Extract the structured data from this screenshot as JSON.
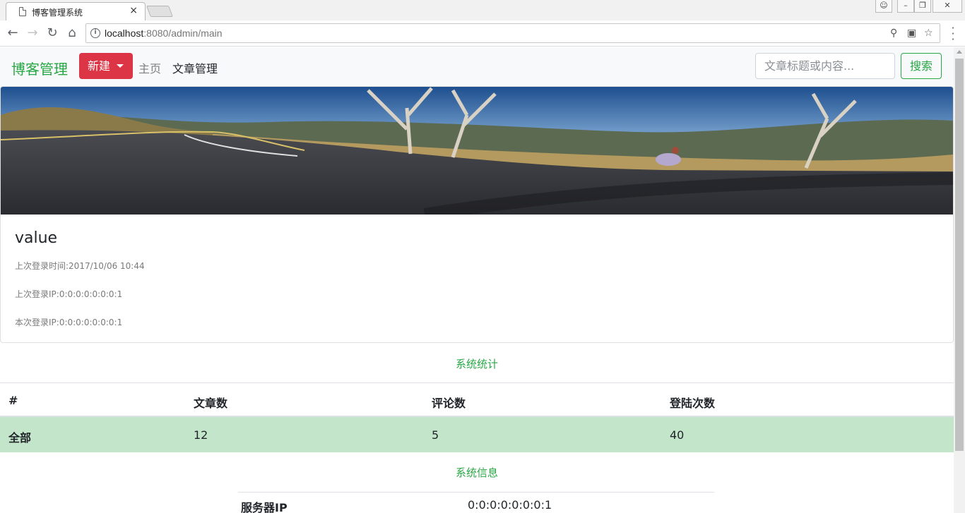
{
  "browser": {
    "tab_title": "博客管理系统",
    "tab_close": "×",
    "url_host": "localhost",
    "url_rest": ":8080/admin/main"
  },
  "navbar": {
    "brand": "博客管理",
    "new_button": "新建",
    "home_link": "主页",
    "articles_link": "文章管理",
    "search_placeholder": "文章标题或内容...",
    "search_button": "搜索"
  },
  "profile": {
    "name": "value",
    "last_login_time": "上次登录时间:2017/10/06 10:44",
    "last_login_ip": "上次登录IP:0:0:0:0:0:0:0:1",
    "current_login_ip": "本次登录IP:0:0:0:0:0:0:0:1"
  },
  "stats": {
    "title": "系统统计",
    "headers": [
      "#",
      "文章数",
      "评论数",
      "登陆次数"
    ],
    "row": [
      "全部",
      "12",
      "5",
      "40"
    ]
  },
  "system_info": {
    "title": "系统信息",
    "rows": [
      {
        "key": "服务器IP",
        "value": "0:0:0:0:0:0:0:1"
      }
    ]
  },
  "colors": {
    "brand": "#28a745",
    "danger": "#dc3545",
    "success_row": "#c3e6cb"
  }
}
